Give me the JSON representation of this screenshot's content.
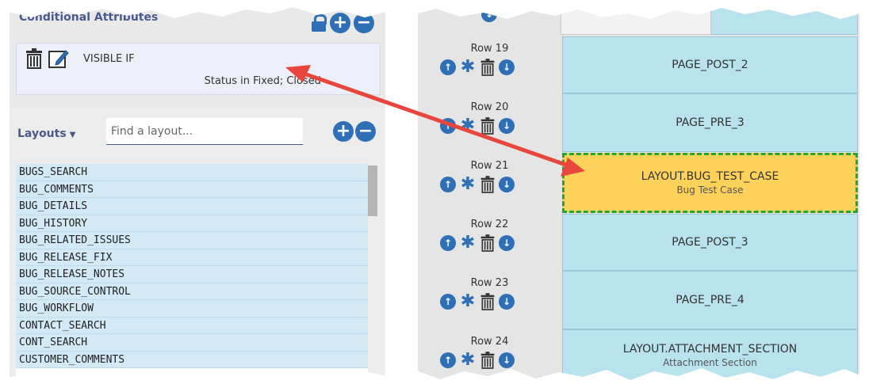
{
  "attributes": {
    "header": "Conditional Attributes",
    "rule_title": "VISIBLE IF",
    "rule_condition": "Status in Fixed; Closed"
  },
  "layouts": {
    "label": "Layouts",
    "search_placeholder": "Find a layout...",
    "items": [
      "BUGS_SEARCH",
      "BUG_COMMENTS",
      "BUG_DETAILS",
      "BUG_HISTORY",
      "BUG_RELATED_ISSUES",
      "BUG_RELEASE_FIX",
      "BUG_RELEASE_NOTES",
      "BUG_SOURCE_CONTROL",
      "BUG_WORKFLOW",
      "CONTACT_SEARCH",
      "CONT_SEARCH",
      "CUSTOMER_COMMENTS"
    ]
  },
  "rows": [
    {
      "label": "Row 19",
      "title": "PAGE_POST_2",
      "subtitle": ""
    },
    {
      "label": "Row 20",
      "title": "PAGE_PRE_3",
      "subtitle": ""
    },
    {
      "label": "Row 21",
      "title": "LAYOUT.BUG_TEST_CASE",
      "subtitle": "Bug Test Case"
    },
    {
      "label": "Row 22",
      "title": "PAGE_POST_3",
      "subtitle": ""
    },
    {
      "label": "Row 23",
      "title": "PAGE_PRE_4",
      "subtitle": ""
    },
    {
      "label": "Row 24",
      "title": "LAYOUT.ATTACHMENT_SECTION",
      "subtitle": "Attachment Section"
    }
  ],
  "colors": {
    "accent": "#2e6fb5",
    "cell": "#b8e3ec",
    "highlight": "#fcd25b",
    "highlight_border": "#22a63a",
    "arrow": "#e8463c",
    "list_item": "#d3e9f6"
  },
  "icons": {
    "lock": "lock-icon",
    "add": "plus-circle-icon",
    "remove": "minus-circle-icon",
    "trash": "trash-icon",
    "edit": "edit-icon",
    "up": "arrow-up-circle-icon",
    "down": "arrow-down-circle-icon",
    "gear": "gear-icon"
  }
}
